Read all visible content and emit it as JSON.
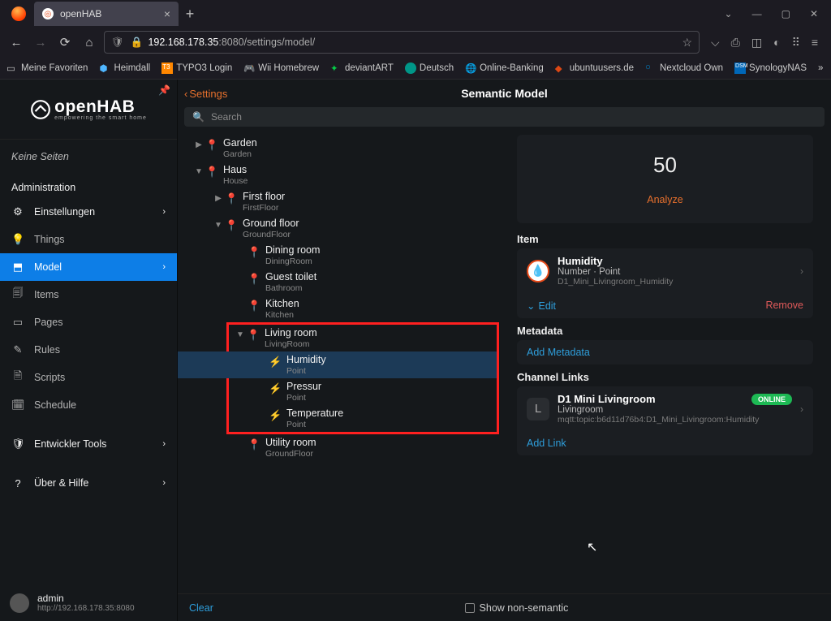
{
  "browser": {
    "tab_title": "openHAB",
    "url_host": "192.168.178.35",
    "url_port": ":8080",
    "url_path": "/settings/model/",
    "bookmarks": [
      "Meine Favoriten",
      "Heimdall",
      "TYPO3 Login",
      "Wii Homebrew",
      "deviantART",
      "Deutsch",
      "Online-Banking",
      "ubuntuusers.de",
      "Nextcloud Own",
      "SynologyNAS"
    ],
    "more_bk": "Weitere Lesezeichen"
  },
  "brand": {
    "name": "openHAB",
    "tagline": "empowering the smart home"
  },
  "sidebar": {
    "empty": "Keine Seiten",
    "admin_title": "Administration",
    "items": [
      {
        "icon": "⚙",
        "label": "Einstellungen",
        "chev": true,
        "top": true
      },
      {
        "icon": "💡",
        "label": "Things"
      },
      {
        "icon": "⬒",
        "label": "Model",
        "active": true,
        "chev": true
      },
      {
        "icon": "🗐",
        "label": "Items"
      },
      {
        "icon": "▭",
        "label": "Pages"
      },
      {
        "icon": "✎",
        "label": "Rules"
      },
      {
        "icon": "🗎",
        "label": "Scripts"
      },
      {
        "icon": "🗓",
        "label": "Schedule"
      }
    ],
    "dev": {
      "icon": "🛡",
      "label": "Entwickler Tools"
    },
    "help": {
      "icon": "?",
      "label": "Über & Hilfe"
    },
    "user": {
      "name": "admin",
      "host": "http://192.168.178.35:8080"
    }
  },
  "header": {
    "back": "Settings",
    "title": "Semantic Model",
    "search_ph": "Search"
  },
  "tree": {
    "garden": {
      "t": "Garden",
      "s": "Garden"
    },
    "haus": {
      "t": "Haus",
      "s": "House"
    },
    "first": {
      "t": "First floor",
      "s": "FirstFloor"
    },
    "ground": {
      "t": "Ground floor",
      "s": "GroundFloor"
    },
    "dining": {
      "t": "Dining room",
      "s": "DiningRoom"
    },
    "guest": {
      "t": "Guest toilet",
      "s": "Bathroom"
    },
    "kitchen": {
      "t": "Kitchen",
      "s": "Kitchen"
    },
    "living": {
      "t": "Living room",
      "s": "LivingRoom"
    },
    "humidity": {
      "t": "Humidity",
      "s": "Point"
    },
    "pressur": {
      "t": "Pressur",
      "s": "Point"
    },
    "temperature": {
      "t": "Temperature",
      "s": "Point"
    },
    "utility": {
      "t": "Utility room",
      "s": "GroundFloor"
    }
  },
  "detail": {
    "value": "50",
    "analyze": "Analyze",
    "item_hdr": "Item",
    "item": {
      "title": "Humidity",
      "sub": "Number · Point",
      "id": "D1_Mini_Livingroom_Humidity"
    },
    "edit": "Edit",
    "remove": "Remove",
    "meta_hdr": "Metadata",
    "add_meta": "Add Metadata",
    "links_hdr": "Channel Links",
    "link": {
      "title": "D1 Mini Livingroom",
      "sub": "Livingroom",
      "id": "mqtt:topic:b6d11d76b4:D1_Mini_Livingroom:Humidity",
      "status": "ONLINE"
    },
    "add_link": "Add Link"
  },
  "footer": {
    "clear": "Clear",
    "show_ns": "Show non-semantic"
  }
}
